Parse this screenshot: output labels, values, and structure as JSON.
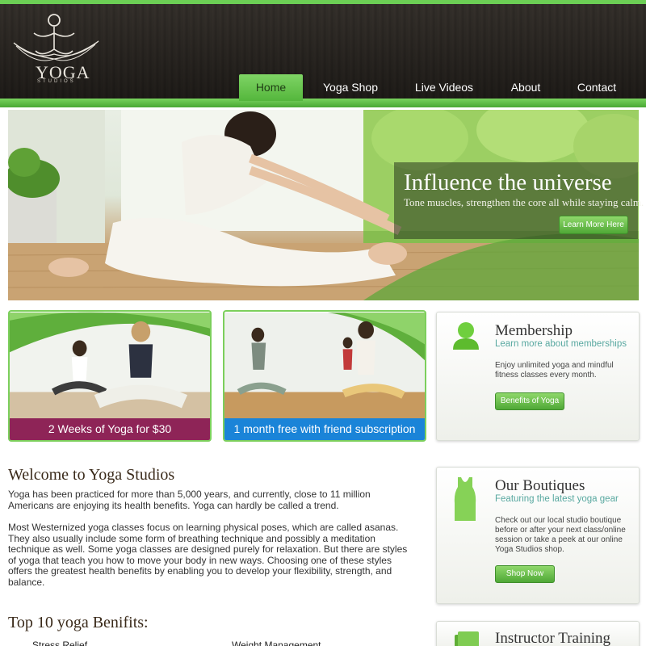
{
  "brand": {
    "name": "YOGA",
    "tagline": "STUDIOS"
  },
  "nav": [
    {
      "label": "Home",
      "active": true
    },
    {
      "label": "Yoga Shop",
      "active": false
    },
    {
      "label": "Live Videos",
      "active": false
    },
    {
      "label": "About",
      "active": false
    },
    {
      "label": "Contact",
      "active": false
    }
  ],
  "hero": {
    "title": "Influence the universe",
    "subtitle": "Tone muscles, strengthen the core all while staying calm.",
    "button": "Learn More Here"
  },
  "promos": [
    {
      "label": "2 Weeks of Yoga for $30",
      "color": "#8e2457"
    },
    {
      "label": "1 month free with friend subscription",
      "color": "#1a84d8"
    }
  ],
  "membership": {
    "title": "Membership",
    "subtitle": "Learn more about memberships",
    "text": "Enjoy unlimited yoga and mindful fitness classes every month.",
    "button": "Benefits of Yoga"
  },
  "boutiques": {
    "title": "Our Boutiques",
    "subtitle": "Featuring the latest yoga gear",
    "text": "Check out our local studio boutique before or after your next class/online session or take a peek at our online Yoga Studios shop.",
    "button": "Shop Now"
  },
  "instructor": {
    "title": "Instructor Training"
  },
  "main": {
    "welcome_title": "Welcome to Yoga Studios",
    "para1": "Yoga has been practiced for more than 5,000 years, and currently, close to 11 million Americans are enjoying its health benefits. Yoga can hardly be called a trend.",
    "para2": "Most Westernized yoga classes focus on learning physical poses, which are called asanas. They also usually include some form of breathing technique and possibly a meditation technique as well. Some yoga classes are designed purely for relaxation. But there are styles of yoga that teach you how to move your body in new ways. Choosing one of these styles offers the greatest health benefits by enabling you to develop your flexibility, strength, and balance.",
    "benefits_title": "Top 10 yoga Benifits:",
    "benefits": [
      "Stress Relief",
      "Weight Management"
    ]
  },
  "colors": {
    "accent": "#6ccf55",
    "header": "#2b2722",
    "promo1": "#8e2457",
    "promo2": "#1a84d8"
  }
}
